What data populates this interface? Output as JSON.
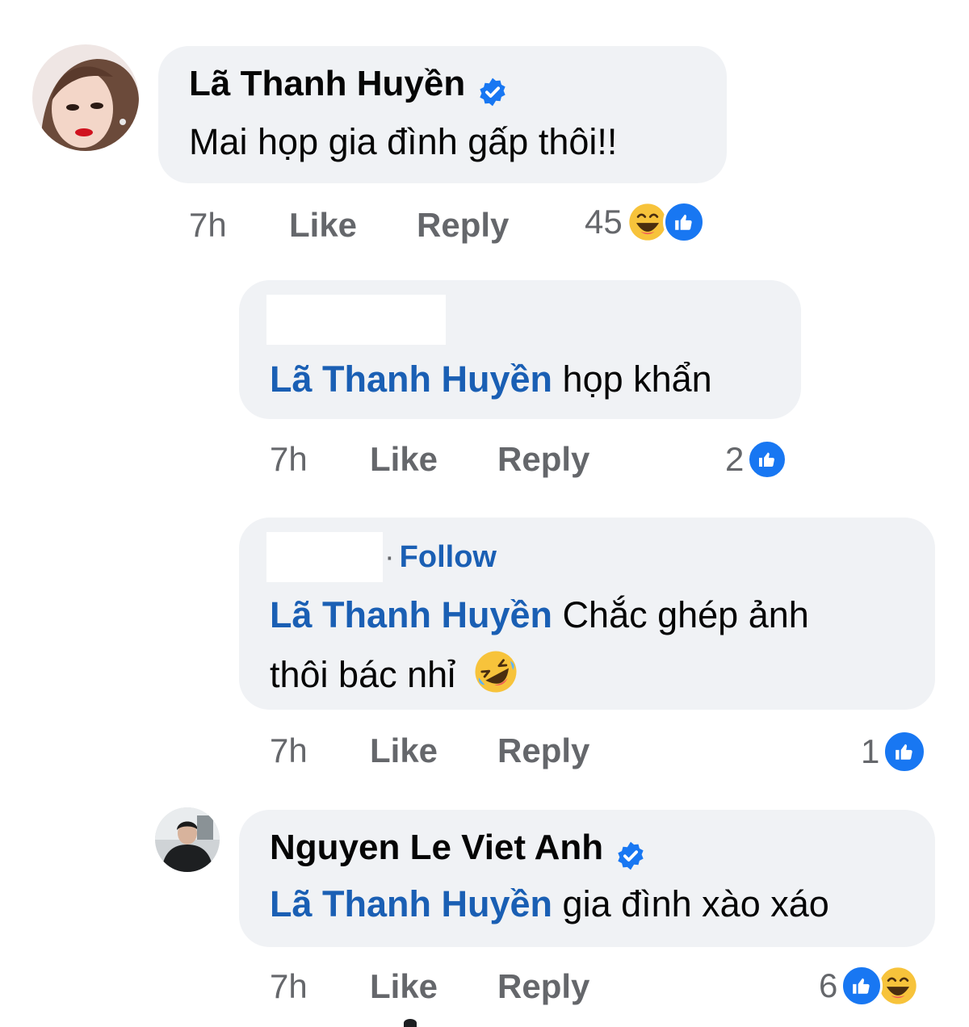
{
  "comments": [
    {
      "author": "Lã Thanh Huyền",
      "text": "Mai họp gia đình gấp thôi!!",
      "time": "7h",
      "like_label": "Like",
      "reply_label": "Reply",
      "reaction_count": "45",
      "reactions": [
        "haha-icon",
        "like-icon"
      ]
    },
    {
      "mention": "Lã Thanh Huyền",
      "text": "họp khẩn",
      "time": "7h",
      "like_label": "Like",
      "reply_label": "Reply",
      "reaction_count": "2",
      "reactions": [
        "like-icon"
      ]
    },
    {
      "follow_separator": "·",
      "follow_label": "Follow",
      "mention": "Lã Thanh Huyền",
      "text_line1": "Chắc ghép ảnh",
      "text_line2": "thôi bác nhỉ",
      "emoji": "rolling-laughing-icon",
      "time": "7h",
      "like_label": "Like",
      "reply_label": "Reply",
      "reaction_count": "1",
      "reactions": [
        "like-icon"
      ]
    },
    {
      "author": "Nguyen Le Viet Anh",
      "mention": "Lã Thanh Huyền",
      "text": "gia đình xào xáo",
      "time": "7h",
      "like_label": "Like",
      "reply_label": "Reply",
      "reaction_count": "6",
      "reactions": [
        "like-icon",
        "haha-icon"
      ]
    }
  ],
  "colors": {
    "bubble": "#f0f2f5",
    "mention": "#1a5fb4",
    "meta_text": "#65676b",
    "like_blue": "#1877f2",
    "haha_yellow": "#f7c33b"
  }
}
